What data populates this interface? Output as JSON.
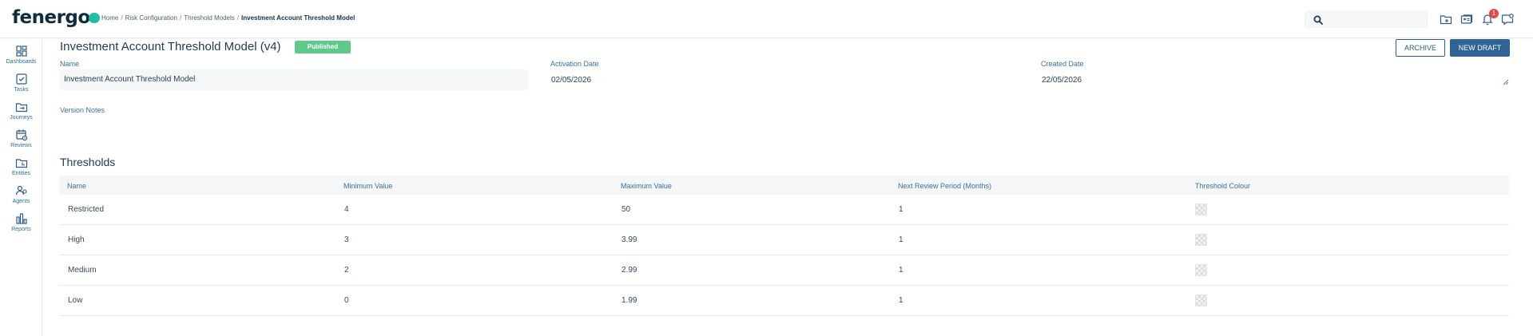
{
  "app": {
    "logo_text": "fenergo"
  },
  "breadcrumb": {
    "items": [
      "Home",
      "Risk Configuration",
      "Threshold Models"
    ],
    "separator": "/",
    "current": "Investment Account Threshold Model"
  },
  "search": {
    "placeholder": "",
    "value": ""
  },
  "header_icons": [
    "folder-plus-icon",
    "id-card-icon",
    "bell-icon",
    "message-icon"
  ],
  "notifications": {
    "count": "1"
  },
  "sidebar": {
    "items": [
      {
        "label": "Dashboards",
        "icon": "dashboard-icon"
      },
      {
        "label": "Tasks",
        "icon": "tasks-icon"
      },
      {
        "label": "Journeys",
        "icon": "journeys-icon"
      },
      {
        "label": "Reviews",
        "icon": "reviews-icon"
      },
      {
        "label": "Entities",
        "icon": "entities-icon"
      },
      {
        "label": "Agents",
        "icon": "agents-icon"
      },
      {
        "label": "Reports",
        "icon": "reports-icon"
      }
    ]
  },
  "page": {
    "title": "Investment Account Threshold Model (v4)",
    "status": "Published",
    "archive_label": "ARCHIVE",
    "new_draft_label": "NEW DRAFT"
  },
  "fields": {
    "name_label": "Name",
    "name_value": "Investment Account Threshold Model",
    "activation_label": "Activation Date",
    "activation_value": "02/05/2026",
    "created_label": "Created Date",
    "created_value": "22/05/2026",
    "version_notes_label": "Version Notes"
  },
  "thresholds": {
    "title": "Thresholds",
    "columns": [
      "Name",
      "Minimum Value",
      "Maximum Value",
      "Next Review Period (Months)",
      "Threshold Colour"
    ],
    "rows": [
      {
        "name": "Restricted",
        "min": "4",
        "max": "50",
        "review": "1"
      },
      {
        "name": "High",
        "min": "3",
        "max": "3.99",
        "review": "1"
      },
      {
        "name": "Medium",
        "min": "2",
        "max": "2.99",
        "review": "1"
      },
      {
        "name": "Low",
        "min": "0",
        "max": "1.99",
        "review": "1"
      }
    ]
  },
  "colors": {
    "brand_dark": "#0f2b3c",
    "brand_accent": "#1fbfa6",
    "primary": "#2e6396",
    "published": "#5fc98a",
    "badge": "#e04c4c",
    "link": "#3d6f9b"
  }
}
